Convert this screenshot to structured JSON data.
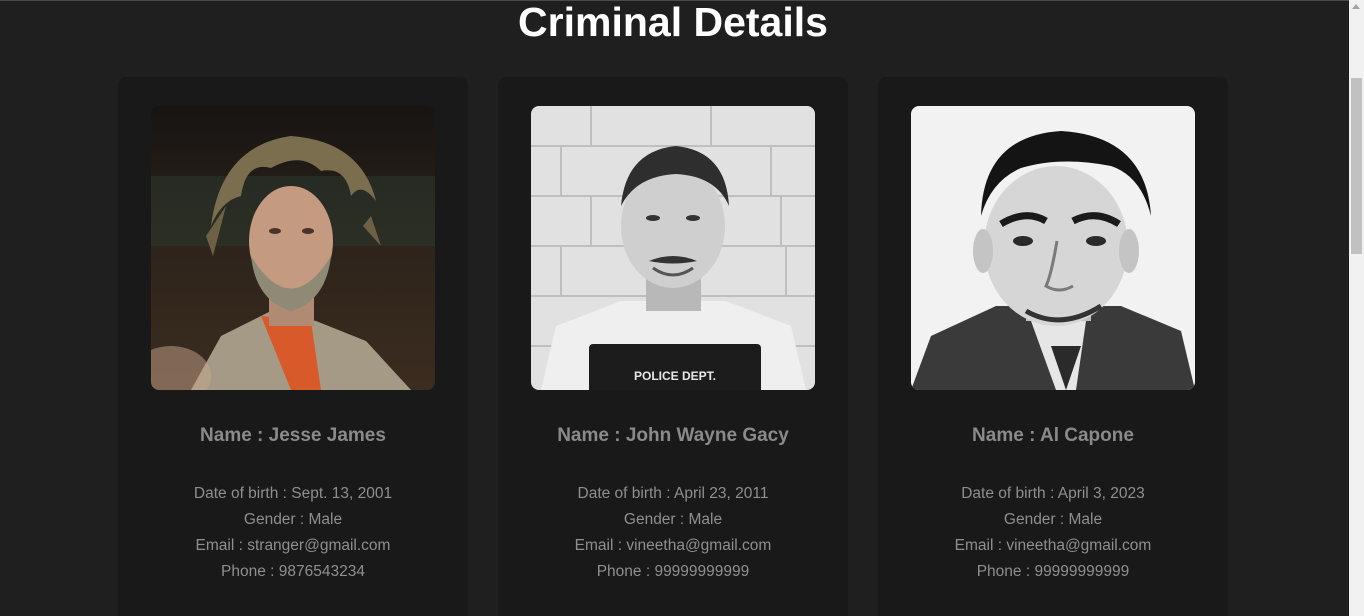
{
  "page": {
    "title": "Criminal Details"
  },
  "colors": {
    "background": "#1f1f1f",
    "card": "#191919",
    "title": "#ffffff",
    "text": "#8f8f8f"
  },
  "criminals": [
    {
      "photo_icon": "mugshot-photo",
      "name": "Name : Jesse James",
      "dob": "Date of birth : Sept. 13, 2001",
      "gender": "Gender : Male",
      "email": "Email : stranger@gmail.com",
      "phone": "Phone : 9876543234"
    },
    {
      "photo_icon": "mugshot-photo",
      "photo_caption": "POLICE DEPT.",
      "name": "Name : John Wayne Gacy",
      "dob": "Date of birth : April 23, 2011",
      "gender": "Gender : Male",
      "email": "Email : vineetha@gmail.com",
      "phone": "Phone : 99999999999"
    },
    {
      "photo_icon": "mugshot-photo",
      "name": "Name : Al Capone",
      "dob": "Date of birth : April 3, 2023",
      "gender": "Gender : Male",
      "email": "Email : vineetha@gmail.com",
      "phone": "Phone : 99999999999"
    }
  ]
}
